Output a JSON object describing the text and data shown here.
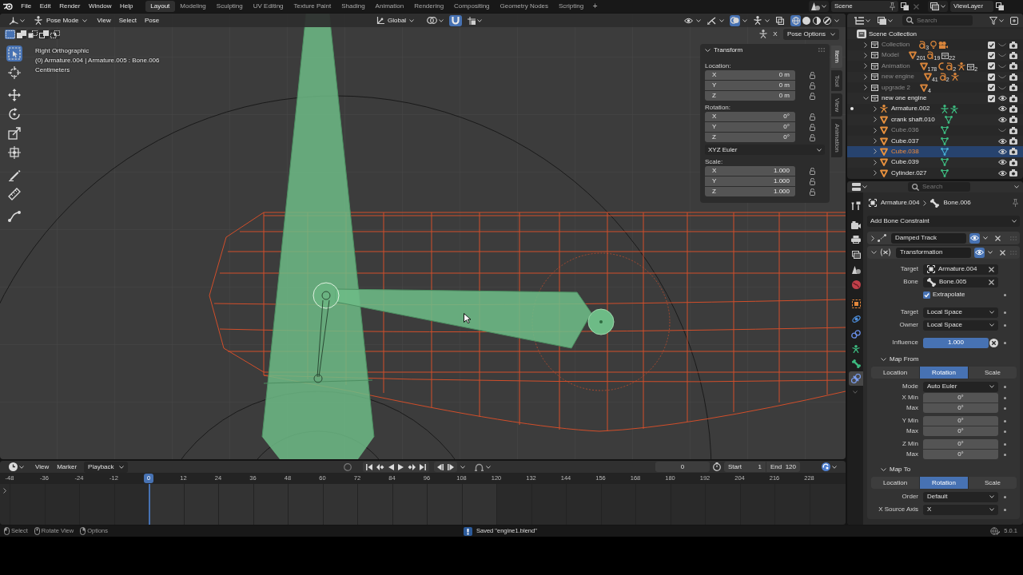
{
  "top_bar": {
    "menus": [
      "File",
      "Edit",
      "Render",
      "Window",
      "Help"
    ],
    "workspaces": [
      {
        "label": "Layout",
        "selected": true
      },
      {
        "label": "Modeling",
        "selected": false
      },
      {
        "label": "Sculpting",
        "selected": false
      },
      {
        "label": "UV Editing",
        "selected": false
      },
      {
        "label": "Texture Paint",
        "selected": false
      },
      {
        "label": "Shading",
        "selected": false
      },
      {
        "label": "Animation",
        "selected": false
      },
      {
        "label": "Rendering",
        "selected": false
      },
      {
        "label": "Compositing",
        "selected": false
      },
      {
        "label": "Geometry Nodes",
        "selected": false
      },
      {
        "label": "Scripting",
        "selected": false
      }
    ],
    "add_workspace": "+",
    "scene": "Scene",
    "view_layer": "ViewLayer"
  },
  "viewport": {
    "mode": "Pose Mode",
    "menus": [
      "View",
      "Select",
      "Pose"
    ],
    "orientation": "Global",
    "snap": {
      "on": true
    },
    "toggles": [
      {
        "kind": "visibility",
        "on": false
      },
      {
        "kind": "gizmo",
        "on": false
      },
      {
        "kind": "overlays",
        "on": true
      },
      {
        "kind": "bone_overlays",
        "on": false
      },
      {
        "kind": "xray",
        "on": false
      }
    ],
    "shading": [
      {
        "kind": "wireframe",
        "selected": true
      },
      {
        "kind": "solid",
        "selected": false
      },
      {
        "kind": "material",
        "selected": false
      },
      {
        "kind": "rendered",
        "selected": false
      }
    ],
    "select_modes": [
      {
        "kind": "set",
        "selected": true
      },
      {
        "kind": "extend",
        "selected": false
      },
      {
        "kind": "subtract",
        "selected": false
      },
      {
        "kind": "invert",
        "selected": false
      },
      {
        "kind": "intersect",
        "selected": false
      }
    ],
    "mirror": "X",
    "pose_options": "Pose Options",
    "tools": [
      {
        "kind": "select_box",
        "selected": true
      },
      {
        "kind": "cursor",
        "selected": false
      },
      {
        "kind": "move",
        "selected": false
      },
      {
        "kind": "rotate",
        "selected": false
      },
      {
        "kind": "scale",
        "selected": false
      },
      {
        "kind": "transform",
        "selected": false
      },
      {
        "kind": "annotate",
        "selected": false
      },
      {
        "kind": "measure",
        "selected": false
      },
      {
        "kind": "relax",
        "selected": false
      }
    ],
    "info": [
      "Right Orthographic",
      "(0) Armature.004 | Armature.005 : Bone.006",
      "Centimeters"
    ],
    "sidebar": {
      "title": "Transform",
      "expanded": true,
      "sections": [
        {
          "label": "Location:",
          "fields": [
            {
              "axis": "X",
              "value": "0 m"
            },
            {
              "axis": "Y",
              "value": "0 m"
            },
            {
              "axis": "Z",
              "value": "0 m"
            }
          ]
        },
        {
          "label": "Rotation:",
          "fields": [
            {
              "axis": "X",
              "value": "0°"
            },
            {
              "axis": "Y",
              "value": "0°"
            },
            {
              "axis": "Z",
              "value": "0°"
            }
          ],
          "mode": "XYZ Euler"
        },
        {
          "label": "Scale:",
          "fields": [
            {
              "axis": "X",
              "value": "1.000"
            },
            {
              "axis": "Y",
              "value": "1.000"
            },
            {
              "axis": "Z",
              "value": "1.000"
            }
          ]
        }
      ],
      "tabs": [
        {
          "label": "Item",
          "selected": true
        },
        {
          "label": "Tool",
          "selected": false
        },
        {
          "label": "View",
          "selected": false
        },
        {
          "label": "Animation",
          "selected": false
        }
      ]
    }
  },
  "timeline": {
    "menus": [
      "View",
      "Marker"
    ],
    "playback": "Playback",
    "current_frame": "0",
    "start_label": "Start",
    "start": "1",
    "end_label": "End",
    "end": "120",
    "ticks": [
      {
        "label": "-48",
        "selected": false
      },
      {
        "label": "-36",
        "selected": false
      },
      {
        "label": "-24",
        "selected": false
      },
      {
        "label": "-12",
        "selected": false
      },
      {
        "label": "0",
        "selected": true
      },
      {
        "label": "12",
        "selected": false
      },
      {
        "label": "24",
        "selected": false
      },
      {
        "label": "36",
        "selected": false
      },
      {
        "label": "48",
        "selected": false
      },
      {
        "label": "60",
        "selected": false
      },
      {
        "label": "72",
        "selected": false
      },
      {
        "label": "84",
        "selected": false
      },
      {
        "label": "96",
        "selected": false
      },
      {
        "label": "108",
        "selected": false
      },
      {
        "label": "120",
        "selected": false
      },
      {
        "label": "132",
        "selected": false
      },
      {
        "label": "144",
        "selected": false
      },
      {
        "label": "156",
        "selected": false
      },
      {
        "label": "168",
        "selected": false
      },
      {
        "label": "180",
        "selected": false
      },
      {
        "label": "192",
        "selected": false
      },
      {
        "label": "204",
        "selected": false
      },
      {
        "label": "216",
        "selected": false
      },
      {
        "label": "228",
        "selected": false
      }
    ]
  },
  "outliner": {
    "search_placeholder": "Search",
    "tree": {
      "label": "Scene Collection",
      "children": [
        {
          "label": "Collection",
          "kind": "collection",
          "expanded": false,
          "included": true,
          "visible": false,
          "selected": false,
          "contents": [
            {
              "kind": "text",
              "count": "3"
            },
            {
              "kind": "light"
            },
            {
              "kind": "camera"
            }
          ]
        },
        {
          "label": "Model",
          "kind": "collection",
          "expanded": false,
          "included": true,
          "visible": false,
          "selected": false,
          "contents": [
            {
              "kind": "mesh",
              "count": "201"
            },
            {
              "kind": "text",
              "count": "19"
            },
            {
              "kind": "collection",
              "count": "22"
            }
          ]
        },
        {
          "label": "Animation",
          "kind": "collection",
          "expanded": false,
          "included": true,
          "visible": false,
          "selected": false,
          "contents": [
            {
              "kind": "mesh",
              "count": "178"
            },
            {
              "kind": "curve"
            },
            {
              "kind": "text",
              "count": "2"
            },
            {
              "kind": "armature"
            },
            {
              "kind": "collection",
              "count": "2"
            }
          ]
        },
        {
          "label": "new engine",
          "kind": "collection",
          "expanded": false,
          "included": true,
          "visible": false,
          "selected": false,
          "contents": [
            {
              "kind": "mesh",
              "count": "41"
            },
            {
              "kind": "text",
              "count": "2"
            },
            {
              "kind": "armature"
            }
          ]
        },
        {
          "label": "upgrade 2",
          "kind": "collection",
          "expanded": false,
          "included": true,
          "visible": false,
          "selected": false,
          "contents": [
            {
              "kind": "mesh",
              "count": "4"
            }
          ]
        },
        {
          "label": "new one engine",
          "kind": "collection",
          "expanded": true,
          "included": true,
          "visible": true,
          "selected": false,
          "children": [
            {
              "label": "Armature.002",
              "kind": "armature",
              "expanded": false,
              "visible": true,
              "selected": false,
              "in_pose_mode": true,
              "contents": [
                {
                  "kind": "pose"
                },
                {
                  "kind": "armature_data"
                }
              ]
            },
            {
              "label": "crank shaft.010",
              "kind": "mesh",
              "expanded": false,
              "visible": true,
              "selected": false,
              "in_pose_mode": false,
              "contents": [
                {
                  "kind": "mesh_data"
                }
              ]
            },
            {
              "label": "Cube.036",
              "kind": "mesh",
              "expanded": false,
              "visible": false,
              "selected": false,
              "in_pose_mode": false,
              "contents": [
                {
                  "kind": "mesh_data"
                }
              ]
            },
            {
              "label": "Cube.037",
              "kind": "mesh",
              "expanded": false,
              "visible": true,
              "selected": false,
              "in_pose_mode": false,
              "contents": [
                {
                  "kind": "mesh_data"
                }
              ]
            },
            {
              "label": "Cube.038",
              "kind": "mesh",
              "expanded": false,
              "visible": true,
              "selected": true,
              "in_pose_mode": false,
              "contents": [
                {
                  "kind": "mesh_data"
                }
              ]
            },
            {
              "label": "Cube.039",
              "kind": "mesh",
              "expanded": false,
              "visible": true,
              "selected": false,
              "in_pose_mode": false,
              "contents": [
                {
                  "kind": "mesh_data"
                }
              ]
            },
            {
              "label": "Cylinder.027",
              "kind": "mesh",
              "expanded": false,
              "visible": true,
              "selected": false,
              "in_pose_mode": false,
              "contents": [
                {
                  "kind": "mesh_data"
                }
              ]
            }
          ]
        }
      ]
    }
  },
  "properties": {
    "search_placeholder": "Search",
    "tabs": [
      {
        "kind": "tool",
        "selected": false
      },
      {
        "kind": "render",
        "selected": false
      },
      {
        "kind": "output",
        "selected": false
      },
      {
        "kind": "view_layer",
        "selected": false
      },
      {
        "kind": "scene",
        "selected": false
      },
      {
        "kind": "world",
        "selected": false
      },
      {
        "kind": "object",
        "selected": false
      },
      {
        "kind": "physics",
        "selected": false
      },
      {
        "kind": "object_constraint",
        "selected": false
      },
      {
        "kind": "data",
        "selected": false
      },
      {
        "kind": "bone",
        "selected": false
      },
      {
        "kind": "bone_constraint",
        "selected": true
      }
    ],
    "breadcrumb": [
      {
        "kind": "armature",
        "label": "Armature.004"
      },
      {
        "kind": "bone",
        "label": "Bone.006"
      }
    ],
    "add_constraint": "Add Bone Constraint",
    "constraints": [
      {
        "kind": "damped_track",
        "name": "Damped Track",
        "expanded": false,
        "enabled": true
      },
      {
        "kind": "transformation",
        "name": "Transformation",
        "expanded": true,
        "enabled": true,
        "rows": [
          {
            "kind": "object",
            "label": "Target",
            "value": "Armature.004"
          },
          {
            "kind": "bone",
            "label": "Bone",
            "value": "Bone.005"
          },
          {
            "kind": "checkbox",
            "label": "Extrapolate",
            "checked": true
          },
          {
            "kind": "dropdown",
            "label": "Target",
            "value": "Local Space"
          },
          {
            "kind": "dropdown",
            "label": "Owner",
            "value": "Local Space"
          },
          {
            "kind": "slider",
            "label": "Influence",
            "value": "1.000",
            "level": 1
          },
          {
            "kind": "subpanel",
            "title": "Map From",
            "expanded": true,
            "rows": [
              {
                "kind": "segmented",
                "options": [
                  {
                    "label": "Location",
                    "selected": false
                  },
                  {
                    "label": "Rotation",
                    "selected": true
                  },
                  {
                    "label": "Scale",
                    "selected": false
                  }
                ]
              },
              {
                "kind": "dropdown",
                "label": "Mode",
                "value": "Auto Euler"
              },
              {
                "kind": "range",
                "rows": [
                  {
                    "label": "X Min",
                    "value": "0°"
                  },
                  {
                    "label": "Max",
                    "value": "0°"
                  }
                ]
              },
              {
                "kind": "range",
                "rows": [
                  {
                    "label": "Y Min",
                    "value": "0°"
                  },
                  {
                    "label": "Max",
                    "value": "0°"
                  }
                ]
              },
              {
                "kind": "range",
                "rows": [
                  {
                    "label": "Z Min",
                    "value": "0°"
                  },
                  {
                    "label": "Max",
                    "value": "0°"
                  }
                ]
              }
            ]
          },
          {
            "kind": "subpanel",
            "title": "Map To",
            "expanded": true,
            "rows": [
              {
                "kind": "segmented",
                "options": [
                  {
                    "label": "Location",
                    "selected": false
                  },
                  {
                    "label": "Rotation",
                    "selected": true
                  },
                  {
                    "label": "Scale",
                    "selected": false
                  }
                ]
              },
              {
                "kind": "dropdown",
                "label": "Order",
                "value": "Default"
              },
              {
                "kind": "dropdown",
                "label": "X Source Axis",
                "value": "X"
              }
            ]
          }
        ]
      }
    ]
  },
  "status_bar": {
    "hints": [
      {
        "kind": "left_click",
        "label": "Select"
      },
      {
        "kind": "middle_click",
        "label": "Rotate View"
      },
      {
        "kind": "right_click",
        "label": "Options"
      }
    ],
    "message": "Saved \"engine1.blend\"",
    "version": "5.0.1"
  }
}
